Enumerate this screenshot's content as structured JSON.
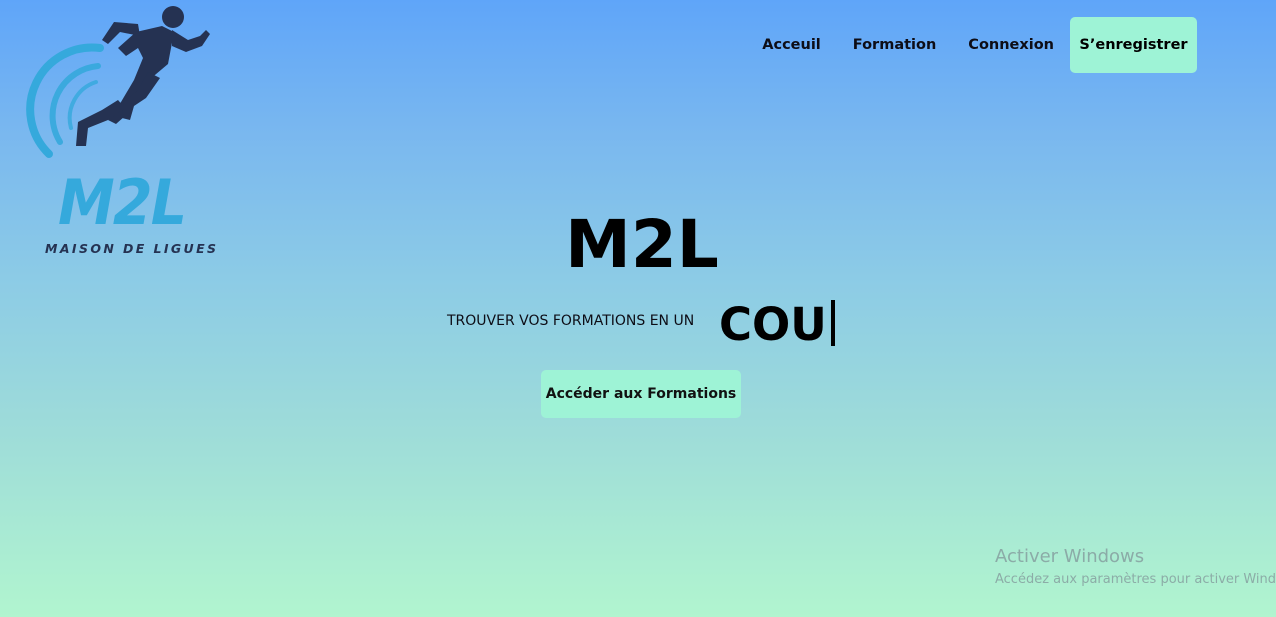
{
  "logo": {
    "mark": "M2L",
    "subtitle": "MAISON DE LIGUES"
  },
  "nav": {
    "items": [
      {
        "label": "Acceuil"
      },
      {
        "label": "Formation"
      },
      {
        "label": "Connexion"
      }
    ],
    "register_label": "S’enregistrer"
  },
  "hero": {
    "title": "M2L",
    "tagline": "TROUVER VOS FORMATIONS EN UN",
    "typed_text": "COU",
    "cta_label": "Accéder aux Formations"
  },
  "watermark": {
    "title": "Activer Windows",
    "subtitle": "Accédez aux paramètres pour activer Windows."
  },
  "colors": {
    "gradient_top": "#5fa5f9",
    "gradient_bottom": "#b1f5cf",
    "button_bg": "#9ef3d6",
    "logo_blue": "#35a9dc",
    "logo_navy": "#253252"
  }
}
